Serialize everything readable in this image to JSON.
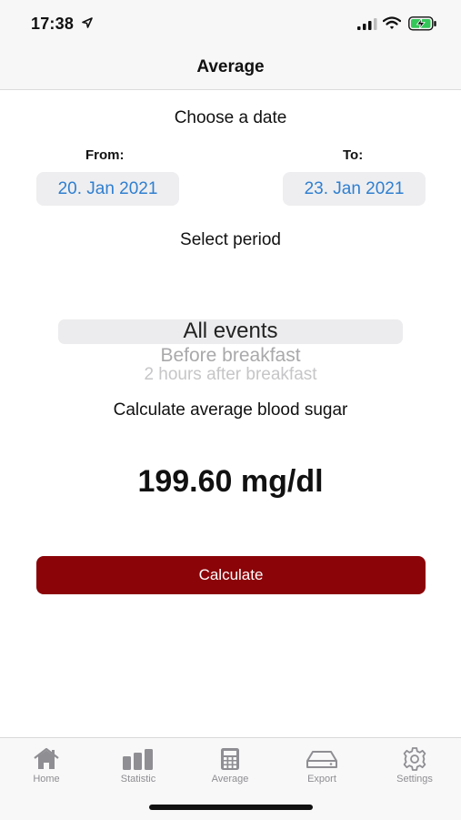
{
  "status_bar": {
    "time": "17:38"
  },
  "nav": {
    "title": "Average"
  },
  "date_section": {
    "heading": "Choose a date",
    "from_label": "From:",
    "to_label": "To:",
    "from_value": "20. Jan 2021",
    "to_value": "23. Jan 2021"
  },
  "period": {
    "heading": "Select period",
    "options": [
      "All events",
      "Before breakfast",
      "2 hours after breakfast"
    ],
    "selected": "All events"
  },
  "calculation": {
    "heading": "Calculate average blood sugar",
    "result": "199.60 mg/dl",
    "button_label": "Calculate"
  },
  "tabs": [
    {
      "label": "Home",
      "icon": "home-icon"
    },
    {
      "label": "Statistic",
      "icon": "bar-chart-icon"
    },
    {
      "label": "Average",
      "icon": "calculator-icon"
    },
    {
      "label": "Export",
      "icon": "drive-icon"
    },
    {
      "label": "Settings",
      "icon": "gear-icon"
    }
  ],
  "colors": {
    "accent_blue": "#2f7fd0",
    "button_red": "#8b0408",
    "battery_green": "#33c759",
    "tab_inactive": "#8e8e93"
  }
}
